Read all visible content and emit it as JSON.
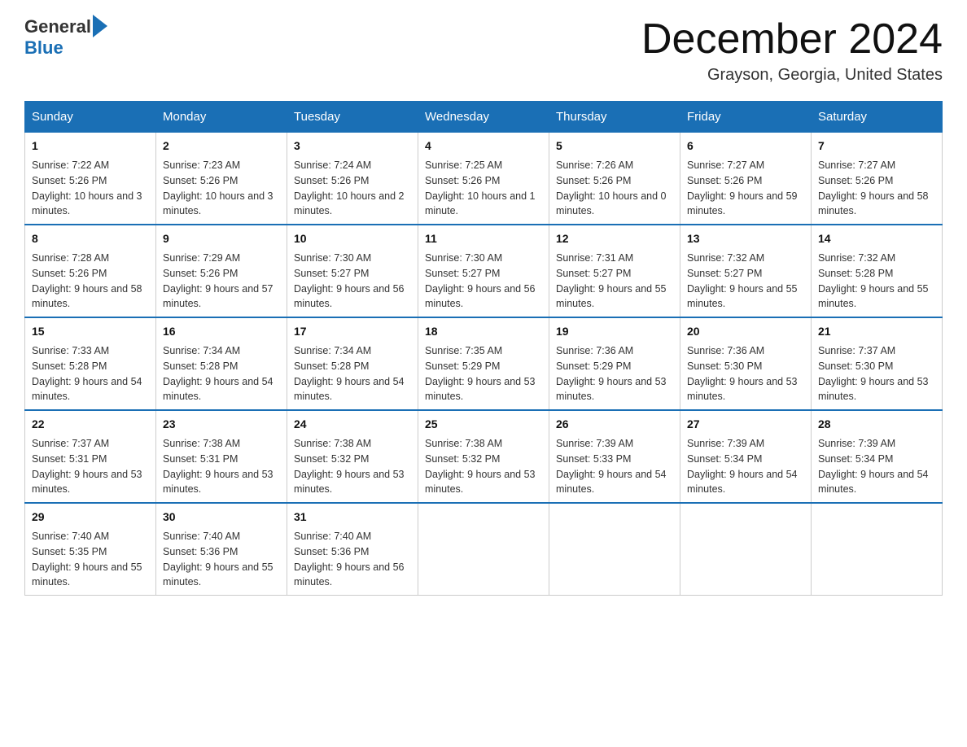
{
  "header": {
    "logo_general": "General",
    "logo_blue": "Blue",
    "month_title": "December 2024",
    "location": "Grayson, Georgia, United States"
  },
  "days_of_week": [
    "Sunday",
    "Monday",
    "Tuesday",
    "Wednesday",
    "Thursday",
    "Friday",
    "Saturday"
  ],
  "weeks": [
    [
      {
        "day": "1",
        "sunrise": "7:22 AM",
        "sunset": "5:26 PM",
        "daylight": "10 hours and 3 minutes."
      },
      {
        "day": "2",
        "sunrise": "7:23 AM",
        "sunset": "5:26 PM",
        "daylight": "10 hours and 3 minutes."
      },
      {
        "day": "3",
        "sunrise": "7:24 AM",
        "sunset": "5:26 PM",
        "daylight": "10 hours and 2 minutes."
      },
      {
        "day": "4",
        "sunrise": "7:25 AM",
        "sunset": "5:26 PM",
        "daylight": "10 hours and 1 minute."
      },
      {
        "day": "5",
        "sunrise": "7:26 AM",
        "sunset": "5:26 PM",
        "daylight": "10 hours and 0 minutes."
      },
      {
        "day": "6",
        "sunrise": "7:27 AM",
        "sunset": "5:26 PM",
        "daylight": "9 hours and 59 minutes."
      },
      {
        "day": "7",
        "sunrise": "7:27 AM",
        "sunset": "5:26 PM",
        "daylight": "9 hours and 58 minutes."
      }
    ],
    [
      {
        "day": "8",
        "sunrise": "7:28 AM",
        "sunset": "5:26 PM",
        "daylight": "9 hours and 58 minutes."
      },
      {
        "day": "9",
        "sunrise": "7:29 AM",
        "sunset": "5:26 PM",
        "daylight": "9 hours and 57 minutes."
      },
      {
        "day": "10",
        "sunrise": "7:30 AM",
        "sunset": "5:27 PM",
        "daylight": "9 hours and 56 minutes."
      },
      {
        "day": "11",
        "sunrise": "7:30 AM",
        "sunset": "5:27 PM",
        "daylight": "9 hours and 56 minutes."
      },
      {
        "day": "12",
        "sunrise": "7:31 AM",
        "sunset": "5:27 PM",
        "daylight": "9 hours and 55 minutes."
      },
      {
        "day": "13",
        "sunrise": "7:32 AM",
        "sunset": "5:27 PM",
        "daylight": "9 hours and 55 minutes."
      },
      {
        "day": "14",
        "sunrise": "7:32 AM",
        "sunset": "5:28 PM",
        "daylight": "9 hours and 55 minutes."
      }
    ],
    [
      {
        "day": "15",
        "sunrise": "7:33 AM",
        "sunset": "5:28 PM",
        "daylight": "9 hours and 54 minutes."
      },
      {
        "day": "16",
        "sunrise": "7:34 AM",
        "sunset": "5:28 PM",
        "daylight": "9 hours and 54 minutes."
      },
      {
        "day": "17",
        "sunrise": "7:34 AM",
        "sunset": "5:28 PM",
        "daylight": "9 hours and 54 minutes."
      },
      {
        "day": "18",
        "sunrise": "7:35 AM",
        "sunset": "5:29 PM",
        "daylight": "9 hours and 53 minutes."
      },
      {
        "day": "19",
        "sunrise": "7:36 AM",
        "sunset": "5:29 PM",
        "daylight": "9 hours and 53 minutes."
      },
      {
        "day": "20",
        "sunrise": "7:36 AM",
        "sunset": "5:30 PM",
        "daylight": "9 hours and 53 minutes."
      },
      {
        "day": "21",
        "sunrise": "7:37 AM",
        "sunset": "5:30 PM",
        "daylight": "9 hours and 53 minutes."
      }
    ],
    [
      {
        "day": "22",
        "sunrise": "7:37 AM",
        "sunset": "5:31 PM",
        "daylight": "9 hours and 53 minutes."
      },
      {
        "day": "23",
        "sunrise": "7:38 AM",
        "sunset": "5:31 PM",
        "daylight": "9 hours and 53 minutes."
      },
      {
        "day": "24",
        "sunrise": "7:38 AM",
        "sunset": "5:32 PM",
        "daylight": "9 hours and 53 minutes."
      },
      {
        "day": "25",
        "sunrise": "7:38 AM",
        "sunset": "5:32 PM",
        "daylight": "9 hours and 53 minutes."
      },
      {
        "day": "26",
        "sunrise": "7:39 AM",
        "sunset": "5:33 PM",
        "daylight": "9 hours and 54 minutes."
      },
      {
        "day": "27",
        "sunrise": "7:39 AM",
        "sunset": "5:34 PM",
        "daylight": "9 hours and 54 minutes."
      },
      {
        "day": "28",
        "sunrise": "7:39 AM",
        "sunset": "5:34 PM",
        "daylight": "9 hours and 54 minutes."
      }
    ],
    [
      {
        "day": "29",
        "sunrise": "7:40 AM",
        "sunset": "5:35 PM",
        "daylight": "9 hours and 55 minutes."
      },
      {
        "day": "30",
        "sunrise": "7:40 AM",
        "sunset": "5:36 PM",
        "daylight": "9 hours and 55 minutes."
      },
      {
        "day": "31",
        "sunrise": "7:40 AM",
        "sunset": "5:36 PM",
        "daylight": "9 hours and 56 minutes."
      },
      null,
      null,
      null,
      null
    ]
  ],
  "labels": {
    "sunrise": "Sunrise:",
    "sunset": "Sunset:",
    "daylight": "Daylight:"
  }
}
